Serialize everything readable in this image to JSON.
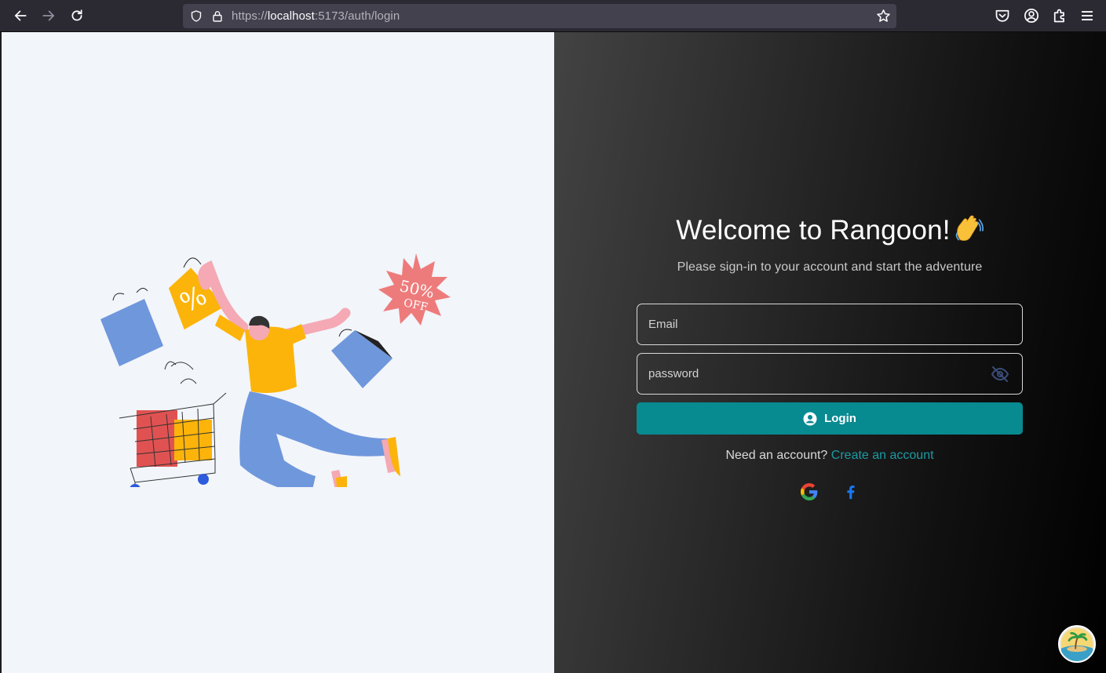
{
  "browser": {
    "url_prefix": "https://",
    "url_host": "localhost",
    "url_rest": ":5173/auth/login"
  },
  "login": {
    "title": "Welcome to Rangoon!",
    "subtitle": "Please sign-in to your account and start the adventure",
    "email_placeholder": "Email",
    "password_placeholder": "password",
    "login_label": "Login",
    "need_account": "Need an account?",
    "create_account": "Create an account"
  },
  "illustration": {
    "sale_line1": "50%",
    "sale_line2": "OFF",
    "bag_symbol": "%"
  },
  "colors": {
    "accent": "#088a91",
    "link": "#1c9ba3",
    "left_bg": "#f2f5fa"
  },
  "icons": [
    "back-icon",
    "forward-icon",
    "reload-icon",
    "shield-icon",
    "lock-icon",
    "star-icon",
    "pocket-icon",
    "account-icon",
    "extensions-icon",
    "menu-icon",
    "eye-off-icon",
    "user-circle-icon",
    "google-icon",
    "facebook-icon"
  ]
}
